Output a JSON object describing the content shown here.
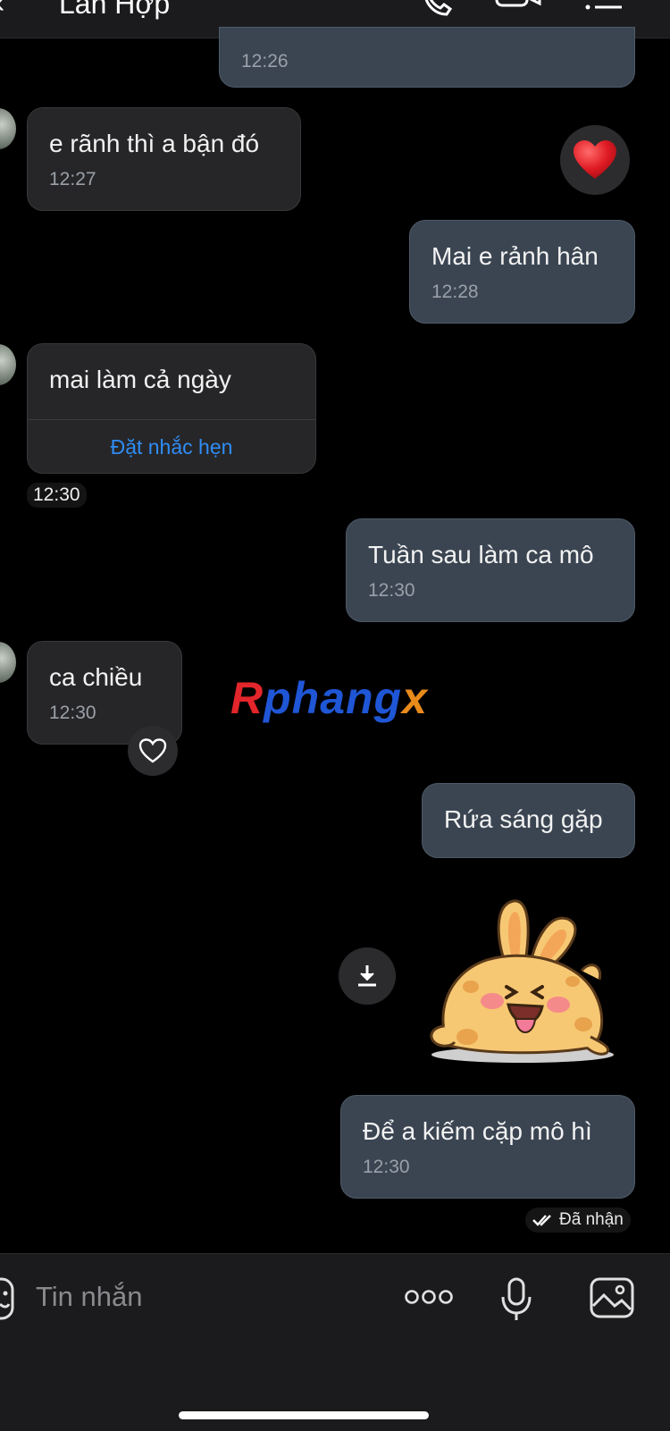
{
  "header": {
    "title": "Lan Hợp",
    "back_icon": "chevron-left-icon",
    "call_icon": "phone-icon",
    "video_icon": "video-camera-icon",
    "menu_icon": "list-icon"
  },
  "messages": [
    {
      "side": "out",
      "text": "",
      "time": "12:26"
    },
    {
      "side": "in",
      "text": "e rãnh thì a bận đó",
      "time": "12:27",
      "reaction": "❤️"
    },
    {
      "side": "out",
      "text": "Mai e rảnh hân",
      "time": "12:28"
    },
    {
      "side": "in",
      "text": "mai làm cả ngày",
      "action": "Đặt nhắc hẹn",
      "time": "12:30"
    },
    {
      "side": "out",
      "text": "Tuần sau làm ca mô",
      "time": "12:30"
    },
    {
      "side": "in",
      "text": "ca chiều",
      "time": "12:30"
    },
    {
      "side": "out",
      "text": "Rứa sáng gặp"
    },
    {
      "side": "out",
      "type": "sticker",
      "sticker": "yellow-bunny-sticker"
    },
    {
      "side": "out",
      "text": "Để a kiếm cặp mô hì",
      "time": "12:30"
    }
  ],
  "status": {
    "text": "Đã nhận",
    "icon": "double-check-icon"
  },
  "watermark": {
    "part1": "R",
    "part2": "phang",
    "part3": "x",
    "color1": "#e3262b",
    "color2": "#1f56d6",
    "color3": "#e88a1a"
  },
  "composer": {
    "placeholder": "Tin nhắn",
    "emoji_icon": "emoji-icon",
    "more_icon": "more-dots-icon",
    "mic_icon": "microphone-icon",
    "image_icon": "image-icon"
  },
  "colors": {
    "background": "#000000",
    "incoming_bubble": "#262628",
    "outgoing_bubble": "#3b4552",
    "link": "#2f8df5"
  }
}
